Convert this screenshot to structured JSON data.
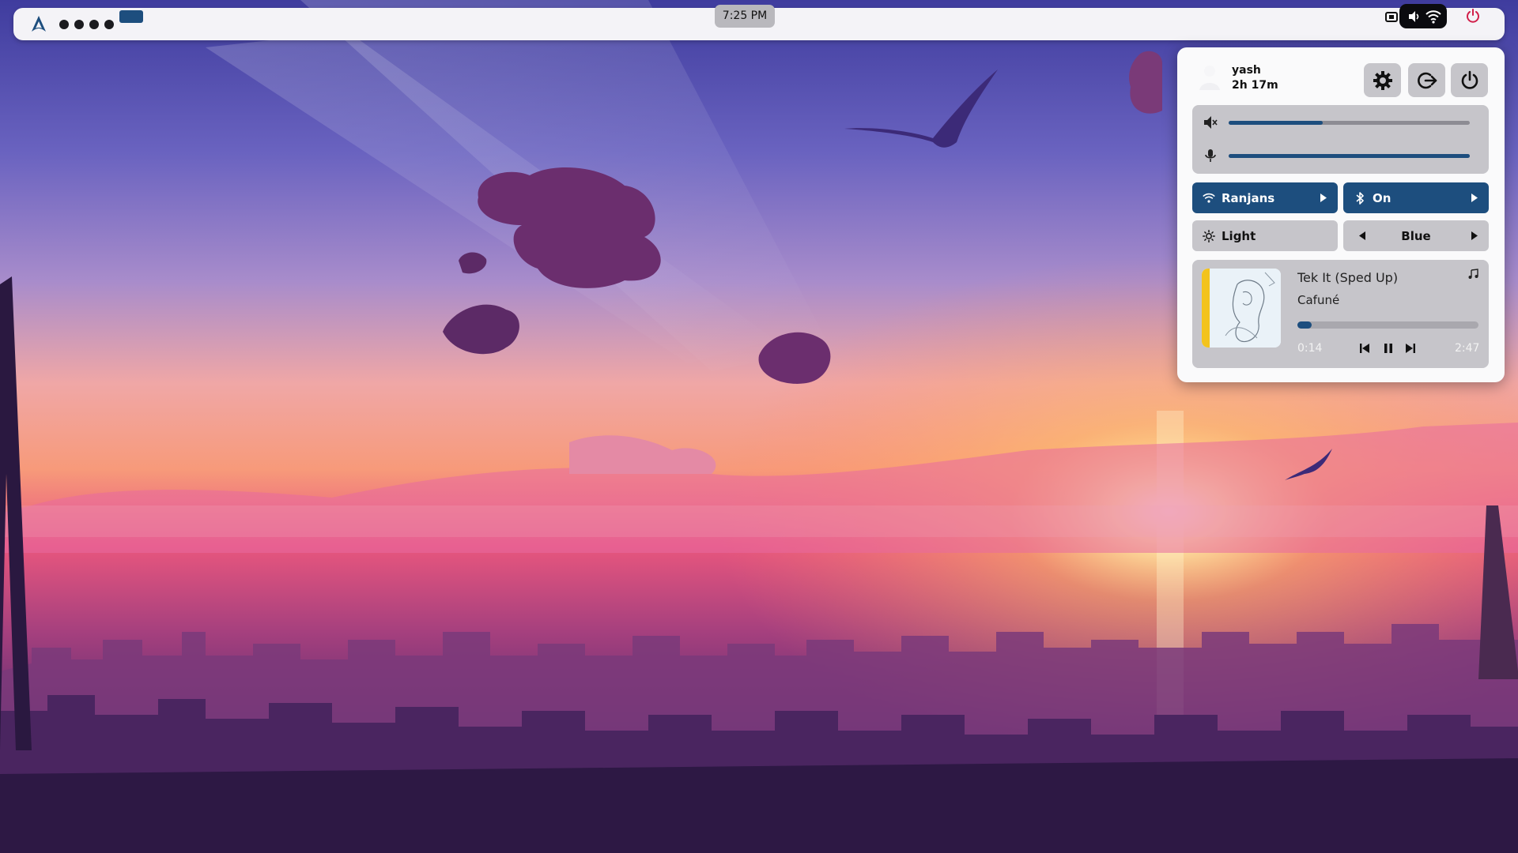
{
  "topbar": {
    "clock": "7:25 PM",
    "workspaces": [
      {
        "id": 1,
        "active": false
      },
      {
        "id": 2,
        "active": false
      },
      {
        "id": 3,
        "active": false
      },
      {
        "id": 4,
        "active": false
      },
      {
        "id": 5,
        "active": true
      }
    ],
    "tray_icons": [
      "screenshot-icon",
      "volume-icon",
      "wifi-icon",
      "power-icon"
    ]
  },
  "control_center": {
    "user": {
      "name": "yash",
      "uptime": "2h 17m"
    },
    "header_buttons": [
      "settings-icon",
      "logout-icon",
      "power-icon"
    ],
    "volume": {
      "level": 0.39,
      "icon": "speaker-icon"
    },
    "microphone": {
      "level": 1.0,
      "icon": "microphone-icon"
    },
    "tiles": {
      "wifi": {
        "label": "Ranjans",
        "icon": "wifi-icon"
      },
      "bluetooth": {
        "label": "On",
        "icon": "bluetooth-icon"
      },
      "theme": {
        "label": "Light",
        "icon": "sun-icon"
      },
      "accent": {
        "label": "Blue"
      }
    },
    "media": {
      "title": "Tek It (Sped Up)",
      "artist": "Cafuné",
      "elapsed": "0:14",
      "total": "2:47",
      "progress": 0.08
    }
  },
  "colors": {
    "accent": "#1d4e7e",
    "panel_bg": "#fafafb",
    "tile_grey": "#c6c5ca",
    "power_red": "#d11f4a"
  }
}
